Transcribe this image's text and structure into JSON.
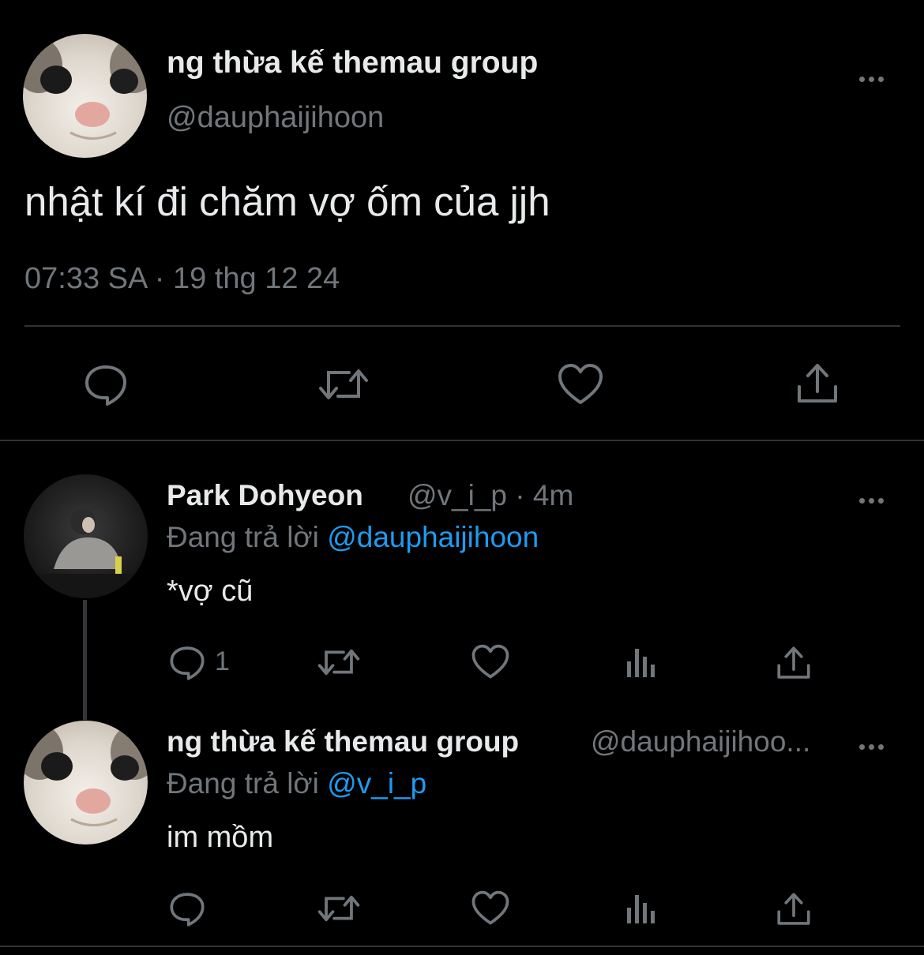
{
  "main_tweet": {
    "display_name": "ng thừa kế themau group",
    "handle": "@dauphaijihoon",
    "text": "nhật kí đi chăm vợ ốm của jjh",
    "timestamp": "07:33 SA · 19 thg 12 24",
    "actions": [
      "reply-icon",
      "retweet-icon",
      "like-icon",
      "share-icon"
    ]
  },
  "replies": [
    {
      "display_name": "Park Dohyeon",
      "meta": "@v_i_p · 4m",
      "replying_prefix": "Đang trả lời",
      "replying_to": "@dauphaijihoon",
      "text": "*vợ cũ",
      "reply_count": "1",
      "actions": [
        "reply-icon",
        "retweet-icon",
        "like-icon",
        "analytics-icon",
        "share-icon"
      ]
    },
    {
      "display_name": "ng thừa kế themau group",
      "meta": "@dauphaijihoo...",
      "replying_prefix": "Đang trả lời",
      "replying_to": "@v_i_p",
      "text": "im mồm",
      "actions": [
        "reply-icon",
        "retweet-icon",
        "like-icon",
        "analytics-icon",
        "share-icon"
      ]
    }
  ],
  "colors": {
    "background": "#000000",
    "text": "#e7e9ea",
    "muted": "#71767b",
    "link": "#1d9bf0",
    "divider": "#2f3336"
  }
}
